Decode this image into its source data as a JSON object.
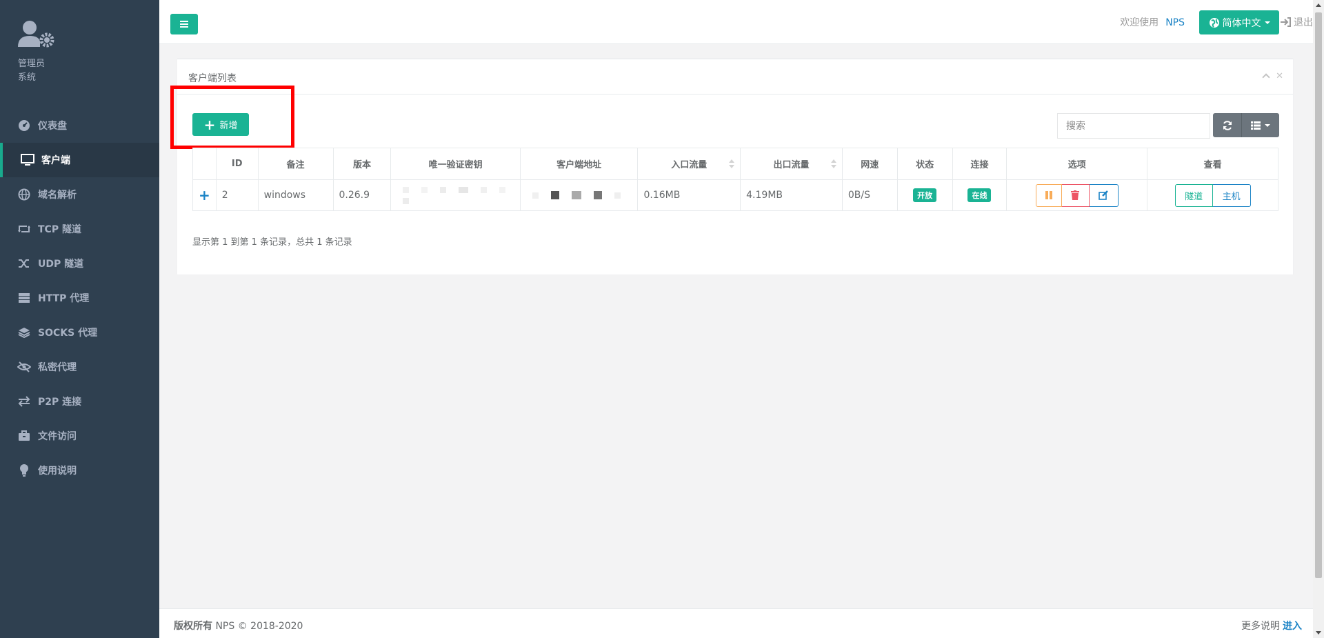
{
  "sidebar": {
    "role": "管理员",
    "system": "系统",
    "items": [
      {
        "label": "仪表盘",
        "icon": "dashboard-icon"
      },
      {
        "label": "客户端",
        "icon": "monitor-icon"
      },
      {
        "label": "域名解析",
        "icon": "globe-icon"
      },
      {
        "label": "TCP 隧道",
        "icon": "retweet-icon"
      },
      {
        "label": "UDP 隧道",
        "icon": "random-icon"
      },
      {
        "label": "HTTP 代理",
        "icon": "server-icon"
      },
      {
        "label": "SOCKS 代理",
        "icon": "layers-icon"
      },
      {
        "label": "私密代理",
        "icon": "eye-slash-icon"
      },
      {
        "label": "P2P 连接",
        "icon": "exchange-icon"
      },
      {
        "label": "文件访问",
        "icon": "briefcase-icon"
      },
      {
        "label": "使用说明",
        "icon": "lightbulb-icon"
      }
    ]
  },
  "topbar": {
    "welcome": "欢迎使用",
    "brand": "NPS",
    "language": "简体中文",
    "logout": "退出"
  },
  "panel": {
    "title": "客户端列表",
    "add_label": "新增",
    "search_placeholder": "搜索",
    "pager_info": "显示第 1 到第 1 条记录，总共 1 条记录"
  },
  "table": {
    "headers": [
      "",
      "ID",
      "备注",
      "版本",
      "唯一验证密钥",
      "客户端地址",
      "入口流量",
      "出口流量",
      "网速",
      "状态",
      "连接",
      "选项",
      "查看"
    ],
    "rows": [
      {
        "expander": "+",
        "id": "2",
        "remark": "windows",
        "version": "0.26.9",
        "in_flow": "0.16MB",
        "out_flow": "4.19MB",
        "speed": "0B/S",
        "status": "开放",
        "connection": "在线",
        "view_tunnel": "隧道",
        "view_host": "主机"
      }
    ]
  },
  "footer": {
    "copyright_label": "版权所有",
    "copyright_text": "NPS © 2018-2020",
    "more": "更多说明",
    "enter": "进入"
  },
  "colors": {
    "sidebar_bg": "#2f4050",
    "accent": "#1ab394",
    "link": "#1c84c6",
    "warning": "#f8ac59",
    "danger": "#ed5565",
    "highlight": "#ff0000"
  }
}
